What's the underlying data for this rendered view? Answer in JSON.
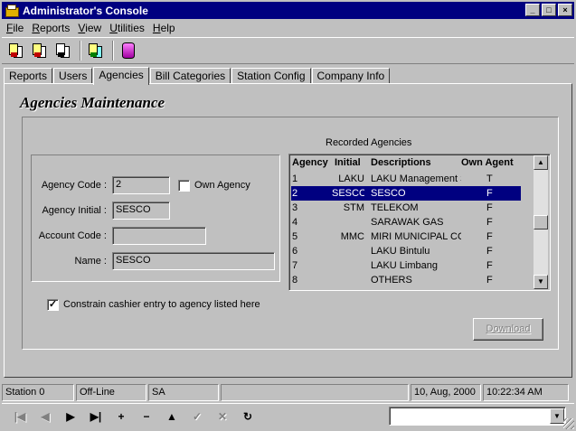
{
  "window": {
    "title": "Administrator's Console",
    "controls": {
      "minimize": "_",
      "maximize": "□",
      "close": "×"
    }
  },
  "menu": [
    {
      "label": "File",
      "accel": "F",
      "rest": "ile"
    },
    {
      "label": "Reports",
      "accel": "R",
      "rest": "eports"
    },
    {
      "label": "View",
      "accel": "V",
      "rest": "iew"
    },
    {
      "label": "Utilities",
      "accel": "U",
      "rest": "tilities"
    },
    {
      "label": "Help",
      "accel": "H",
      "rest": "elp"
    }
  ],
  "toolbar": {
    "icons": [
      "report-icon",
      "report-icon",
      "report-preview-icon",
      "transfer-icon",
      "database-icon"
    ]
  },
  "tabs": [
    {
      "label": "Reports",
      "active": false
    },
    {
      "label": "Users",
      "active": false
    },
    {
      "label": "Agencies",
      "active": true
    },
    {
      "label": "Bill Categories",
      "active": false
    },
    {
      "label": "Station Config",
      "active": false
    },
    {
      "label": "Company Info",
      "active": false
    }
  ],
  "page": {
    "title": "Agencies Maintenance"
  },
  "form": {
    "agency_code_label": "Agency Code :",
    "agency_code_value": "2",
    "own_agency_label": "Own Agency",
    "own_agency_checked": false,
    "agency_initial_label": "Agency Initial :",
    "agency_initial_value": "SESCO",
    "account_code_label": "Account Code :",
    "account_code_value": "",
    "name_label": "Name :",
    "name_value": "SESCO",
    "constrain_label": "Constrain cashier entry to agency listed here",
    "constrain_checked": true,
    "check_mark": "✓"
  },
  "agencies_list": {
    "caption": "Recorded Agencies",
    "headers": {
      "code": "Agency",
      "initial": "Initial",
      "desc": "Descriptions",
      "own": "Own Agent"
    },
    "selected_index": 1,
    "rows": [
      {
        "code": "1",
        "initial": "LAKU",
        "desc": "LAKU Management S",
        "own": "T"
      },
      {
        "code": "2",
        "initial": "SESCO",
        "desc": "SESCO",
        "own": "F"
      },
      {
        "code": "3",
        "initial": "STM",
        "desc": "TELEKOM",
        "own": "F"
      },
      {
        "code": "4",
        "initial": "",
        "desc": "SARAWAK GAS",
        "own": "F"
      },
      {
        "code": "5",
        "initial": "MMC",
        "desc": "MIRI MUNICIPAL CC",
        "own": "F"
      },
      {
        "code": "6",
        "initial": "",
        "desc": "LAKU Bintulu",
        "own": "F"
      },
      {
        "code": "7",
        "initial": "",
        "desc": "LAKU Limbang",
        "own": "F"
      },
      {
        "code": "8",
        "initial": "",
        "desc": "OTHERS",
        "own": "F"
      }
    ]
  },
  "download_button": {
    "label": "Download",
    "enabled": false
  },
  "status": {
    "station": "Station 0",
    "mode": "Off-Line",
    "user": "SA",
    "blank": "",
    "date": "10, Aug, 2000",
    "time": "10:22:34 AM"
  },
  "nav": {
    "first": "|◀",
    "prior": "◀",
    "next": "▶",
    "last": "▶|",
    "insert": "+",
    "delete": "−",
    "edit": "▲",
    "post": "✓",
    "cancel": "✕",
    "refresh": "↻",
    "combo_value": ""
  }
}
